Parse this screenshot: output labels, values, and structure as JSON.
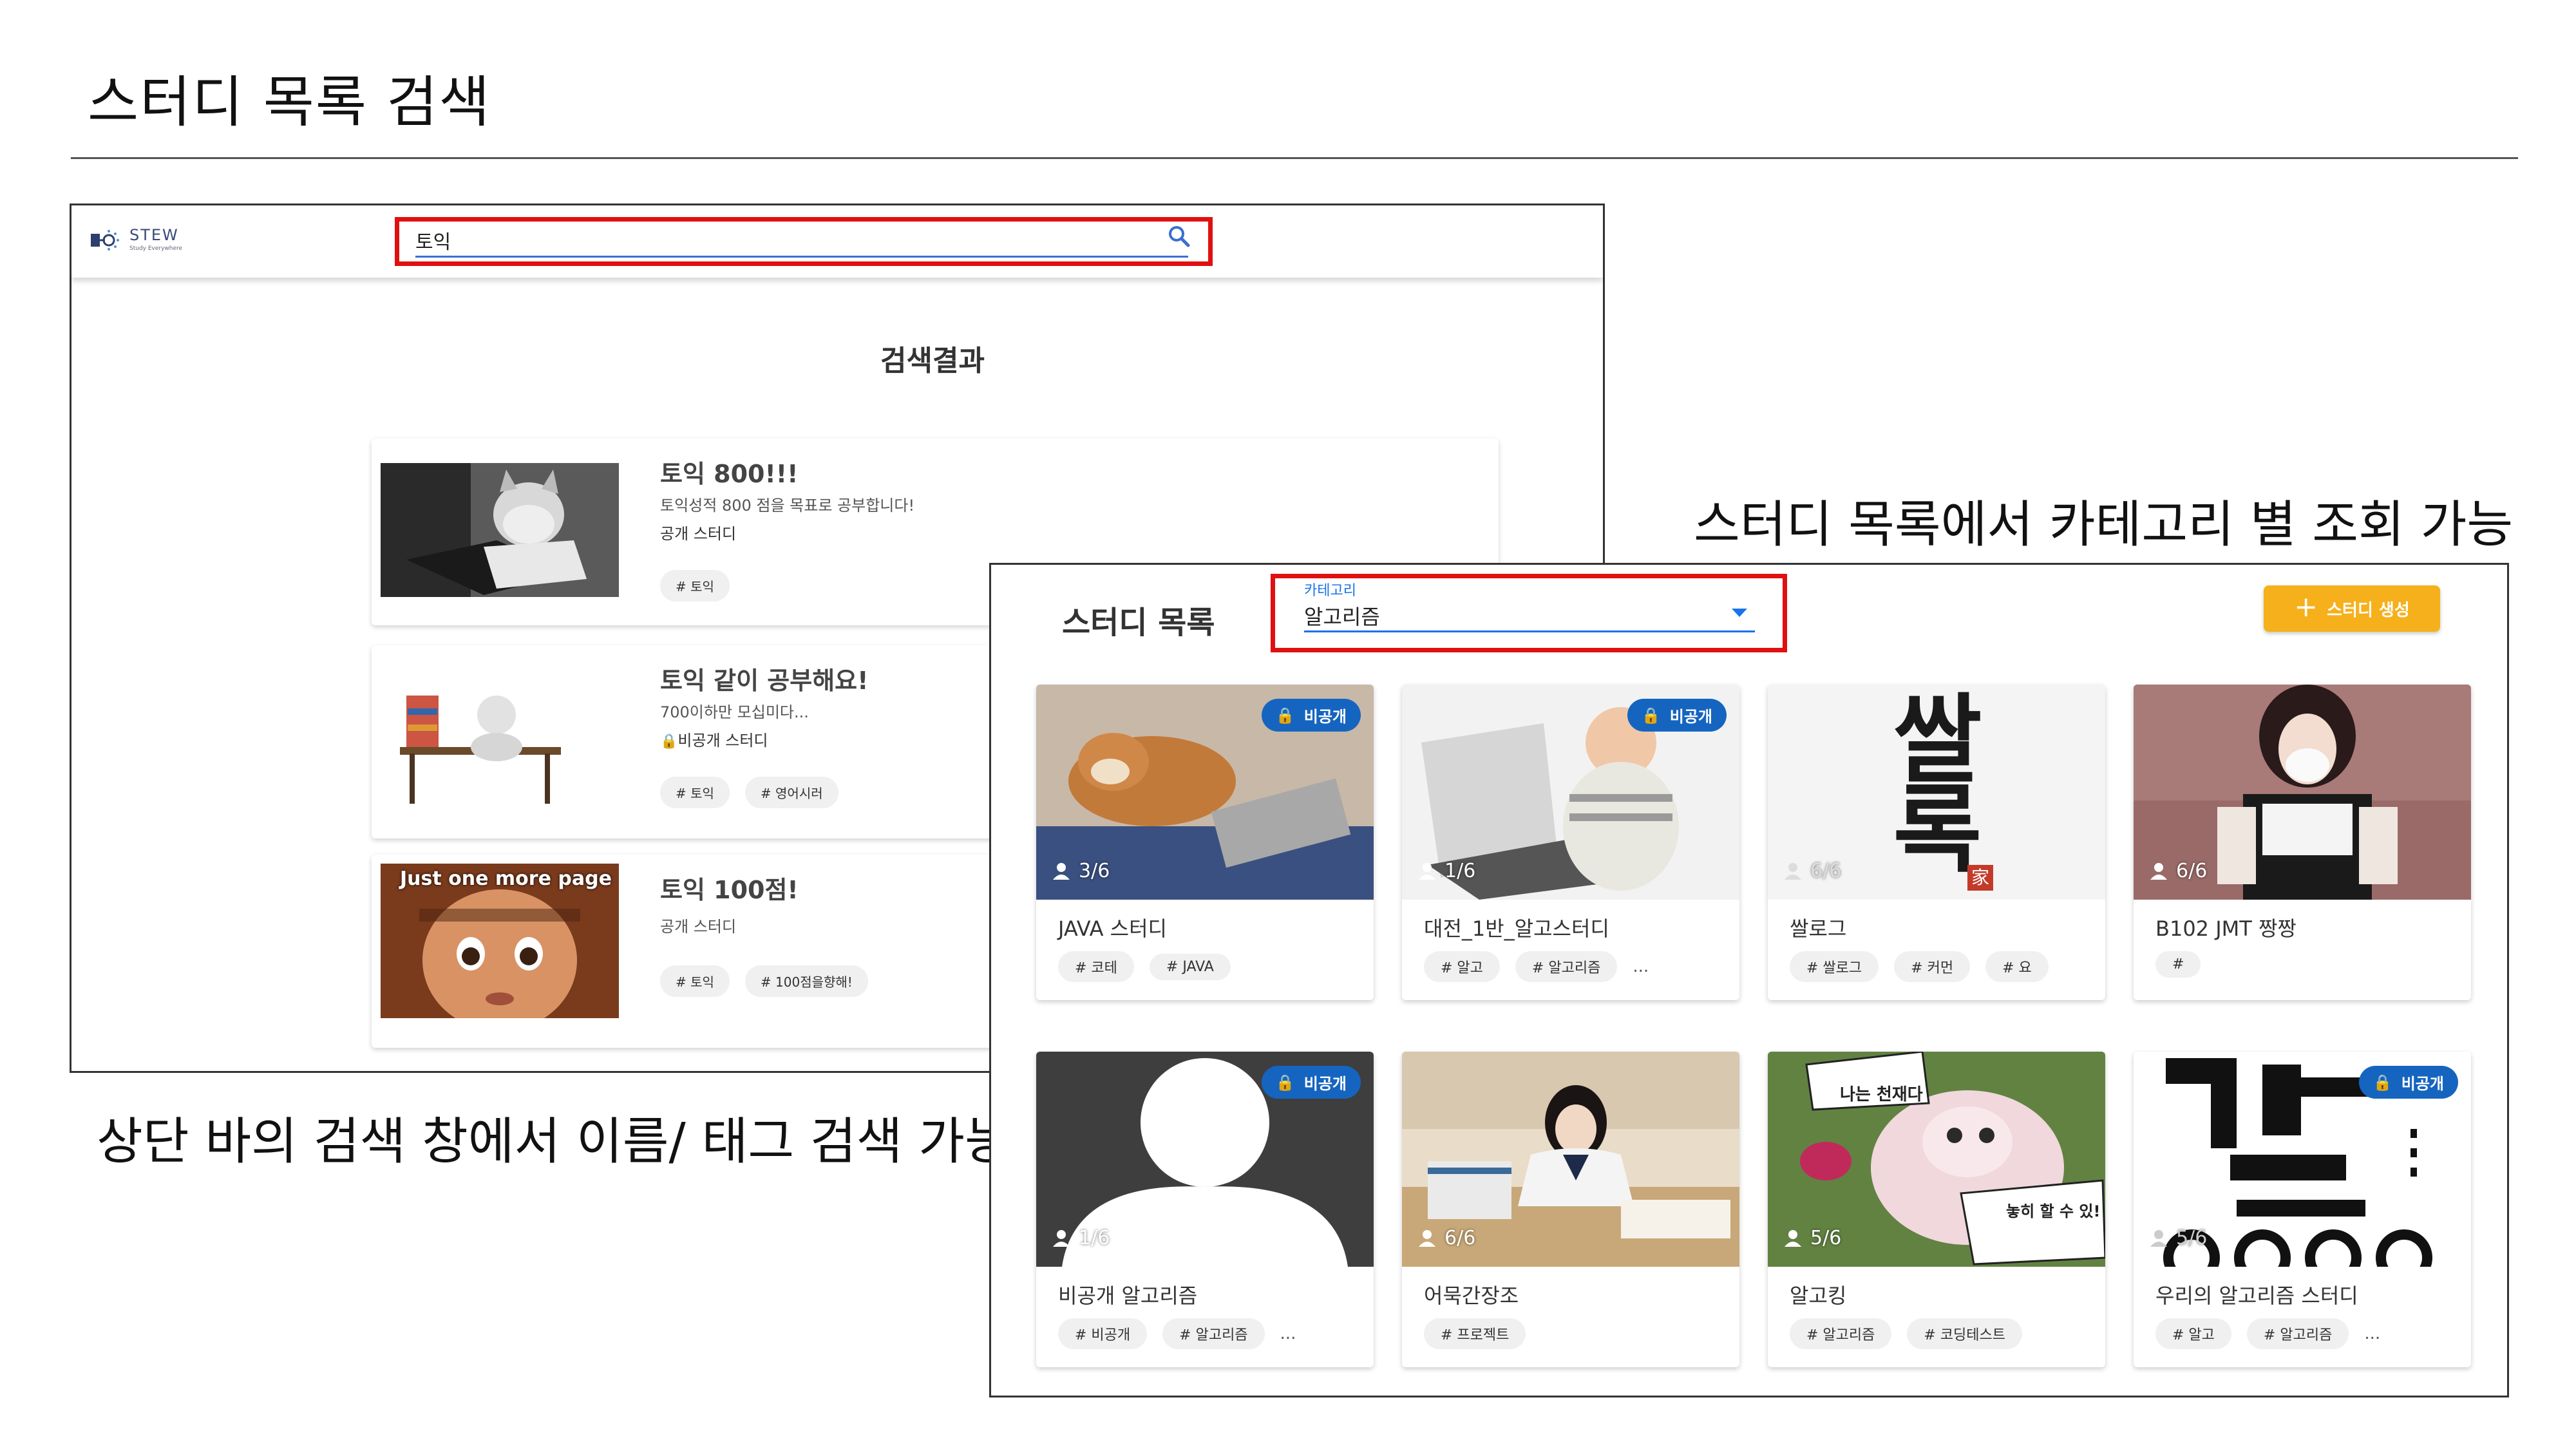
{
  "slide": {
    "title": "스터디 목록 검색",
    "caption_left": "상단 바의 검색 창에서 이름/ 태그 검색 가능",
    "caption_right": "스터디 목록에서 카테고리 별 조회 가능"
  },
  "search_screen": {
    "logo": {
      "text": "STEW",
      "sub": "Study Everywhere"
    },
    "search": {
      "value": "토익"
    },
    "heading": "검색결과",
    "results": [
      {
        "title": "토익 800!!!",
        "description": "토익성적 800 점을 목표로 공부합니다!",
        "visibility": "공개 스터디",
        "tags": [
          "# 토익"
        ]
      },
      {
        "title": "토익 같이 공부해요!",
        "description": "700이하만 모십미다...",
        "visibility": "비공개 스터디",
        "tags": [
          "# 토익",
          "# 영어시러"
        ]
      },
      {
        "title": "토익 100점!",
        "description": "",
        "visibility": "공개 스터디",
        "tags": [
          "# 토익",
          "# 100점을향해!"
        ],
        "thumb_caption": "Just one more page"
      }
    ]
  },
  "list_screen": {
    "title": "스터디 목록",
    "category": {
      "label": "카테고리",
      "value": "알고리즘"
    },
    "create_button": "스터디 생성",
    "private_label": "비공개",
    "cards": [
      {
        "name": "JAVA 스터디",
        "members": "3/6",
        "private": true,
        "tags": [
          "# 코테",
          "# JAVA"
        ],
        "more": ""
      },
      {
        "name": "대전_1반_알고스터디",
        "members": "1/6",
        "private": true,
        "tags": [
          "# 알고",
          "# 알고리즘"
        ],
        "more": "..."
      },
      {
        "name": "쌀로그",
        "members": "6/6",
        "private": false,
        "tags": [
          "# 쌀로그",
          "# 커먼",
          "# 요"
        ],
        "more": "",
        "image_text": "쌀록",
        "stamp": "家"
      },
      {
        "name": "B102 JMT 짱짱",
        "members": "6/6",
        "private": false,
        "tags": [
          "#"
        ],
        "more": ""
      },
      {
        "name": "비공개 알고리즘",
        "members": "1/6",
        "private": true,
        "tags": [
          "# 비공개",
          "# 알고리즘"
        ],
        "more": "..."
      },
      {
        "name": "어묵간장조",
        "members": "6/6",
        "private": false,
        "tags": [
          "# 프로젝트"
        ],
        "more": ""
      },
      {
        "name": "알고킹",
        "members": "5/6",
        "private": false,
        "tags": [
          "# 알고리즘",
          "# 코딩테스트"
        ],
        "more": "",
        "bubble_1": "나는 천재다",
        "bubble_2": "놓히 할 수 있!"
      },
      {
        "name": "우리의 알고리즘 스터디",
        "members": "5/6",
        "private": true,
        "tags": [
          "# 알고",
          "# 알고리즘"
        ],
        "more": "..."
      }
    ]
  },
  "colors": {
    "highlight": "#e01010",
    "accent_blue": "#1a73e8",
    "badge_blue": "#1565c0",
    "button_yellow": "#f6b01b"
  },
  "icons": [
    "search-icon",
    "lock-icon",
    "person-icon",
    "plus-icon",
    "chevron-down-icon"
  ]
}
